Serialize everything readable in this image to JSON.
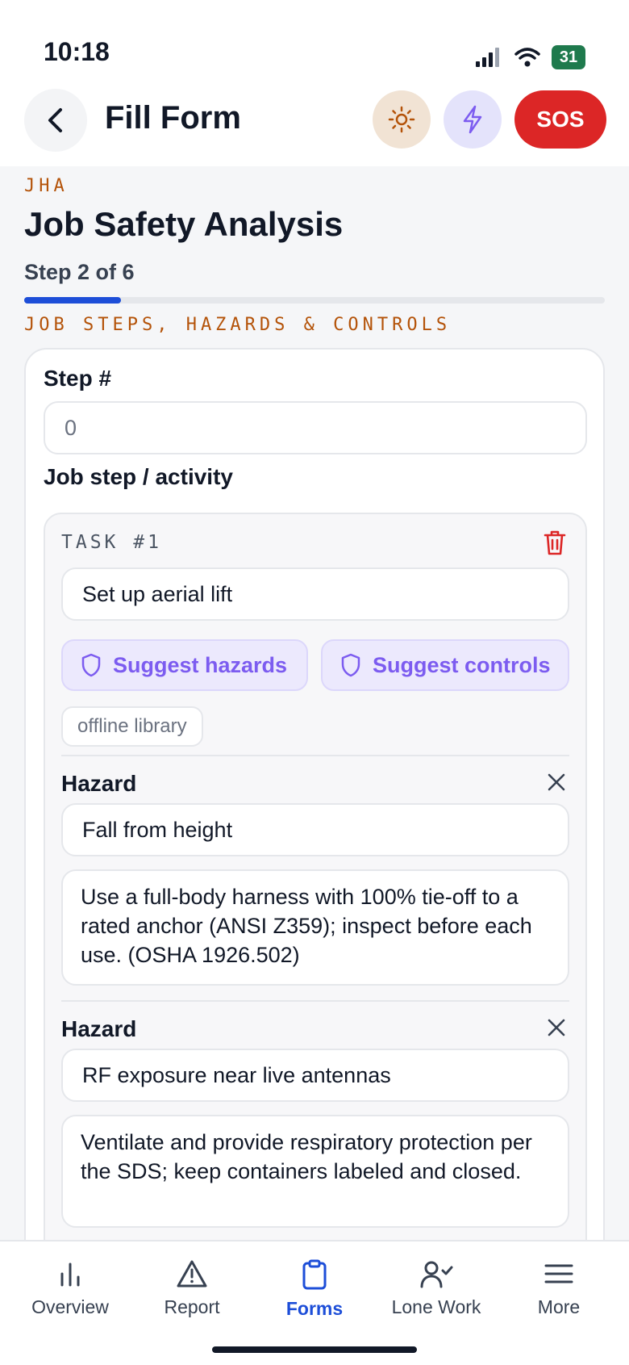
{
  "status": {
    "time": "10:18",
    "battery": "31"
  },
  "header": {
    "title": "Fill Form",
    "sos_label": "SOS"
  },
  "form": {
    "kicker": "JHA",
    "title": "Job Safety Analysis",
    "step_label": "Step 2 of 6",
    "progress": 0.1667,
    "section_title": "JOB STEPS, HAZARDS & CONTROLS"
  },
  "card": {
    "step_field_label": "Step #",
    "step_field_placeholder": "0",
    "activity_label": "Job step / activity",
    "task": {
      "label": "TASK #1",
      "value": "Set up aerial lift",
      "suggest_hazards": "Suggest hazards",
      "suggest_controls": "Suggest controls",
      "source_tag": "offline library",
      "hazards": [
        {
          "label": "Hazard",
          "hazard": "Fall from height",
          "control": "Use a full-body harness with 100% tie-off to a rated anchor (ANSI Z359); inspect before each use. (OSHA 1926.502)"
        },
        {
          "label": "Hazard",
          "hazard": "RF exposure near live antennas",
          "control": "Ventilate and provide respiratory protection per the SDS; keep containers labeled and closed."
        }
      ]
    }
  },
  "nav": {
    "items": [
      {
        "label": "Overview",
        "icon": "bar-chart-icon"
      },
      {
        "label": "Report",
        "icon": "warning-icon"
      },
      {
        "label": "Forms",
        "icon": "clipboard-icon",
        "active": true
      },
      {
        "label": "Lone Work",
        "icon": "user-check-icon"
      },
      {
        "label": "More",
        "icon": "menu-icon"
      }
    ]
  },
  "colors": {
    "accent": "#1d4ed8",
    "sos": "#dc2626",
    "kicker": "#b45309",
    "suggest": "#7c5cf0"
  }
}
